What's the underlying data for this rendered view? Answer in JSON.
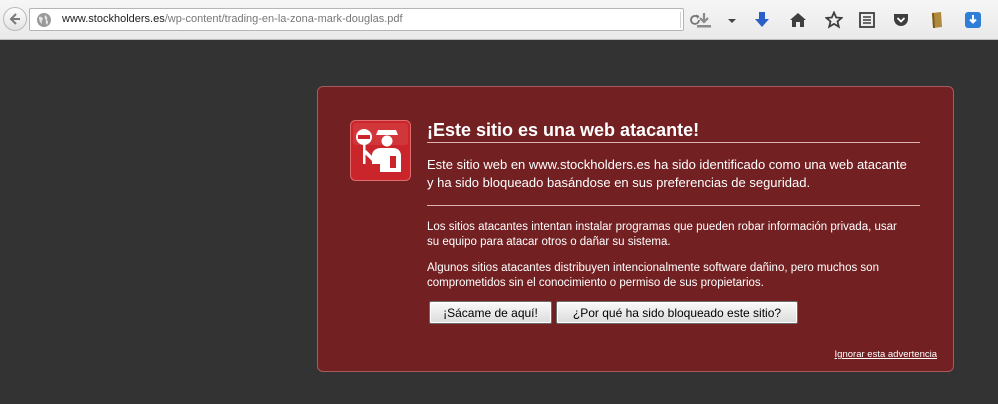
{
  "browser": {
    "url_host": "www.stockholders.es",
    "url_path": "/wp-content/trading-en-la-zona-mark-douglas.pdf"
  },
  "warning": {
    "title": "¡Este sitio es una web atacante!",
    "description": "Este sitio web en www.stockholders.es ha sido identificado como una web atacante y ha sido bloqueado basándose en sus preferencias de seguridad.",
    "paragraph1": "Los sitios atacantes intentan instalar programas que pueden robar información privada, usar su equipo para atacar otros o dañar su sistema.",
    "paragraph2": "Algunos sitios atacantes distribuyen intencionalmente software dañino, pero muchos son comprometidos sin el conocimiento o permiso de sus propietarios.",
    "get_me_out_label": "¡Sácame de aquí!",
    "why_blocked_label": "¿Por qué ha sido bloqueado este sitio?",
    "ignore_label": "Ignorar esta advertencia"
  },
  "colors": {
    "page_background": "#333333",
    "warning_background": "#722022",
    "shield_red": "#c9252b"
  },
  "icons": {
    "back": "back-arrow-icon",
    "site": "globe-icon",
    "reload": "reload-icon",
    "downloads": "download-icon",
    "menu": "dropdown-arrow-icon",
    "pocket_down": "blue-down-arrow-icon",
    "home": "home-icon",
    "bookmark": "star-icon",
    "reader": "reader-list-icon",
    "pocket": "pocket-icon",
    "extension": "bookmark-tag-icon",
    "downloader": "blue-download-icon"
  }
}
